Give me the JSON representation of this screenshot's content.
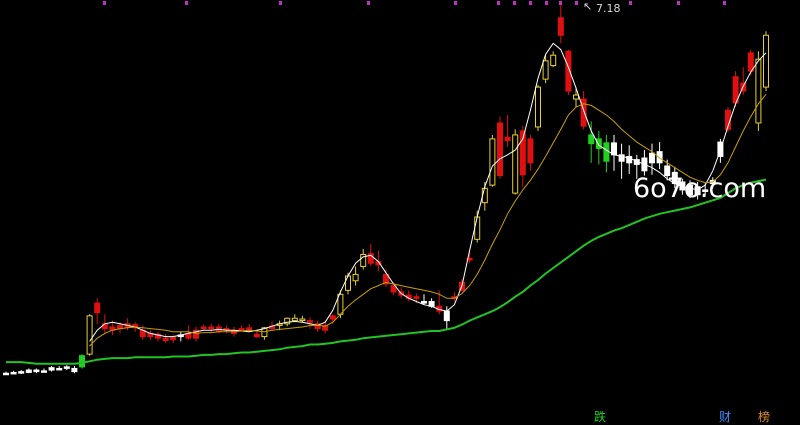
{
  "colors": {
    "background": "#000000",
    "up_candle": "#e01010",
    "down_candle": "#ffffff",
    "yellow_candle": "#e8d030",
    "green_candle": "#20d020",
    "ma_long": "#22c322",
    "ma_mid": "#c8a000",
    "ma_short": "#ffffff",
    "marker": "#c030c0",
    "tag_die": "#20d020",
    "tag_cai": "#3a8cff",
    "tag_bang": "#e08a2a"
  },
  "peak_label": "7.18",
  "watermark": "6o7o.com",
  "tags": {
    "die": "跌",
    "cai": "财",
    "bang": "榜"
  },
  "chart_data": {
    "type": "candlestick",
    "price_range": [
      2.45,
      7.18
    ],
    "max_price": 7.18,
    "candles": [
      {
        "o": 2.56,
        "h": 2.58,
        "l": 2.54,
        "c": 2.55,
        "k": "w"
      },
      {
        "o": 2.57,
        "h": 2.59,
        "l": 2.55,
        "c": 2.56,
        "k": "w"
      },
      {
        "o": 2.58,
        "h": 2.6,
        "l": 2.55,
        "c": 2.57,
        "k": "w"
      },
      {
        "o": 2.6,
        "h": 2.62,
        "l": 2.56,
        "c": 2.57,
        "k": "w"
      },
      {
        "o": 2.58,
        "h": 2.62,
        "l": 2.56,
        "c": 2.6,
        "k": "w"
      },
      {
        "o": 2.59,
        "h": 2.62,
        "l": 2.57,
        "c": 2.58,
        "k": "w"
      },
      {
        "o": 2.6,
        "h": 2.65,
        "l": 2.58,
        "c": 2.63,
        "k": "w"
      },
      {
        "o": 2.62,
        "h": 2.65,
        "l": 2.6,
        "c": 2.61,
        "k": "w"
      },
      {
        "o": 2.63,
        "h": 2.66,
        "l": 2.6,
        "c": 2.64,
        "k": "w"
      },
      {
        "o": 2.62,
        "h": 2.65,
        "l": 2.56,
        "c": 2.58,
        "k": "w"
      },
      {
        "o": 2.64,
        "h": 2.8,
        "l": 2.62,
        "c": 2.78,
        "k": "g"
      },
      {
        "o": 2.8,
        "h": 3.3,
        "l": 2.78,
        "c": 3.28,
        "k": "y"
      },
      {
        "o": 3.32,
        "h": 3.5,
        "l": 3.18,
        "c": 3.44,
        "k": "r"
      },
      {
        "o": 3.18,
        "h": 3.3,
        "l": 3.05,
        "c": 3.12,
        "k": "r"
      },
      {
        "o": 3.14,
        "h": 3.22,
        "l": 3.04,
        "c": 3.1,
        "k": "r"
      },
      {
        "o": 3.12,
        "h": 3.2,
        "l": 3.06,
        "c": 3.16,
        "k": "r"
      },
      {
        "o": 3.18,
        "h": 3.25,
        "l": 3.1,
        "c": 3.14,
        "k": "r"
      },
      {
        "o": 3.13,
        "h": 3.2,
        "l": 3.08,
        "c": 3.17,
        "k": "r"
      },
      {
        "o": 3.1,
        "h": 3.16,
        "l": 2.98,
        "c": 3.02,
        "k": "r"
      },
      {
        "o": 3.02,
        "h": 3.1,
        "l": 2.98,
        "c": 3.06,
        "k": "r"
      },
      {
        "o": 3.05,
        "h": 3.08,
        "l": 2.96,
        "c": 3.0,
        "k": "r"
      },
      {
        "o": 3.0,
        "h": 3.05,
        "l": 2.94,
        "c": 2.97,
        "k": "r"
      },
      {
        "o": 2.98,
        "h": 3.04,
        "l": 2.94,
        "c": 3.01,
        "k": "r"
      },
      {
        "o": 3.02,
        "h": 3.08,
        "l": 2.96,
        "c": 3.04,
        "k": "w"
      },
      {
        "o": 3.06,
        "h": 3.16,
        "l": 2.98,
        "c": 3.0,
        "k": "r"
      },
      {
        "o": 3.0,
        "h": 3.14,
        "l": 2.96,
        "c": 3.1,
        "k": "r"
      },
      {
        "o": 3.12,
        "h": 3.17,
        "l": 3.1,
        "c": 3.14,
        "k": "r"
      },
      {
        "o": 3.12,
        "h": 3.18,
        "l": 3.08,
        "c": 3.14,
        "k": "r"
      },
      {
        "o": 3.14,
        "h": 3.18,
        "l": 3.06,
        "c": 3.08,
        "k": "r"
      },
      {
        "o": 3.1,
        "h": 3.16,
        "l": 3.06,
        "c": 3.12,
        "k": "r"
      },
      {
        "o": 3.1,
        "h": 3.14,
        "l": 3.02,
        "c": 3.06,
        "k": "r"
      },
      {
        "o": 3.12,
        "h": 3.16,
        "l": 3.08,
        "c": 3.1,
        "k": "r"
      },
      {
        "o": 3.13,
        "h": 3.18,
        "l": 3.08,
        "c": 3.11,
        "k": "r"
      },
      {
        "o": 3.05,
        "h": 3.1,
        "l": 3.0,
        "c": 3.02,
        "k": "r"
      },
      {
        "o": 3.02,
        "h": 3.14,
        "l": 2.98,
        "c": 3.13,
        "k": "y"
      },
      {
        "o": 3.15,
        "h": 3.21,
        "l": 3.11,
        "c": 3.12,
        "k": "r"
      },
      {
        "o": 3.16,
        "h": 3.22,
        "l": 3.1,
        "c": 3.18,
        "k": "y"
      },
      {
        "o": 3.18,
        "h": 3.26,
        "l": 3.15,
        "c": 3.25,
        "k": "y"
      },
      {
        "o": 3.25,
        "h": 3.3,
        "l": 3.2,
        "c": 3.22,
        "k": "y"
      },
      {
        "o": 3.24,
        "h": 3.28,
        "l": 3.2,
        "c": 3.23,
        "k": "y"
      },
      {
        "o": 3.22,
        "h": 3.26,
        "l": 3.12,
        "c": 3.2,
        "k": "r"
      },
      {
        "o": 3.18,
        "h": 3.22,
        "l": 3.08,
        "c": 3.12,
        "k": "r"
      },
      {
        "o": 3.16,
        "h": 3.22,
        "l": 3.06,
        "c": 3.1,
        "k": "r"
      },
      {
        "o": 3.24,
        "h": 3.3,
        "l": 3.18,
        "c": 3.28,
        "k": "r"
      },
      {
        "o": 3.3,
        "h": 3.6,
        "l": 3.25,
        "c": 3.55,
        "k": "y"
      },
      {
        "o": 3.6,
        "h": 3.82,
        "l": 3.55,
        "c": 3.78,
        "k": "y"
      },
      {
        "o": 3.72,
        "h": 3.9,
        "l": 3.66,
        "c": 3.8,
        "k": "y"
      },
      {
        "o": 3.9,
        "h": 4.12,
        "l": 3.86,
        "c": 4.05,
        "k": "y"
      },
      {
        "o": 4.06,
        "h": 4.18,
        "l": 3.9,
        "c": 3.94,
        "k": "r"
      },
      {
        "o": 3.96,
        "h": 4.1,
        "l": 3.84,
        "c": 3.92,
        "k": "r"
      },
      {
        "o": 3.8,
        "h": 3.86,
        "l": 3.64,
        "c": 3.68,
        "k": "r"
      },
      {
        "o": 3.66,
        "h": 3.7,
        "l": 3.54,
        "c": 3.58,
        "k": "r"
      },
      {
        "o": 3.58,
        "h": 3.64,
        "l": 3.5,
        "c": 3.54,
        "k": "r"
      },
      {
        "o": 3.54,
        "h": 3.6,
        "l": 3.46,
        "c": 3.5,
        "k": "r"
      },
      {
        "o": 3.5,
        "h": 3.56,
        "l": 3.44,
        "c": 3.52,
        "k": "r"
      },
      {
        "o": 3.46,
        "h": 3.55,
        "l": 3.42,
        "c": 3.44,
        "k": "w"
      },
      {
        "o": 3.46,
        "h": 3.5,
        "l": 3.38,
        "c": 3.4,
        "k": "w"
      },
      {
        "o": 3.4,
        "h": 3.6,
        "l": 3.3,
        "c": 3.34,
        "k": "r"
      },
      {
        "o": 3.34,
        "h": 3.4,
        "l": 3.12,
        "c": 3.22,
        "k": "w"
      },
      {
        "o": 3.5,
        "h": 3.58,
        "l": 3.46,
        "c": 3.52,
        "k": "r"
      },
      {
        "o": 3.6,
        "h": 3.74,
        "l": 3.58,
        "c": 3.7,
        "k": "r"
      },
      {
        "o": 4.0,
        "h": 4.1,
        "l": 3.94,
        "c": 3.98,
        "k": "r"
      },
      {
        "o": 4.24,
        "h": 4.6,
        "l": 4.2,
        "c": 4.52,
        "k": "y"
      },
      {
        "o": 4.7,
        "h": 4.96,
        "l": 4.6,
        "c": 4.88,
        "k": "y"
      },
      {
        "o": 4.92,
        "h": 5.55,
        "l": 4.9,
        "c": 5.5,
        "k": "y"
      },
      {
        "o": 5.7,
        "h": 5.78,
        "l": 5.0,
        "c": 5.04,
        "k": "r"
      },
      {
        "o": 5.52,
        "h": 5.8,
        "l": 5.4,
        "c": 5.48,
        "k": "r"
      },
      {
        "o": 4.82,
        "h": 5.62,
        "l": 4.8,
        "c": 5.55,
        "k": "y"
      },
      {
        "o": 5.6,
        "h": 5.66,
        "l": 4.9,
        "c": 5.05,
        "k": "r"
      },
      {
        "o": 5.2,
        "h": 5.55,
        "l": 5.1,
        "c": 5.5,
        "k": "r"
      },
      {
        "o": 5.65,
        "h": 6.18,
        "l": 5.6,
        "c": 6.15,
        "k": "y"
      },
      {
        "o": 6.25,
        "h": 6.55,
        "l": 6.2,
        "c": 6.48,
        "k": "y"
      },
      {
        "o": 6.55,
        "h": 6.6,
        "l": 6.4,
        "c": 6.42,
        "k": "y"
      },
      {
        "o": 6.8,
        "h": 7.18,
        "l": 6.7,
        "c": 7.02,
        "k": "r"
      },
      {
        "o": 6.6,
        "h": 6.62,
        "l": 6.05,
        "c": 6.1,
        "k": "r"
      },
      {
        "o": 6.0,
        "h": 6.15,
        "l": 5.9,
        "c": 6.05,
        "k": "y"
      },
      {
        "o": 6.0,
        "h": 6.1,
        "l": 5.62,
        "c": 5.66,
        "k": "r"
      },
      {
        "o": 5.55,
        "h": 5.72,
        "l": 5.2,
        "c": 5.44,
        "k": "g"
      },
      {
        "o": 5.5,
        "h": 5.6,
        "l": 5.18,
        "c": 5.38,
        "k": "g"
      },
      {
        "o": 5.45,
        "h": 5.55,
        "l": 5.08,
        "c": 5.22,
        "k": "g"
      },
      {
        "o": 5.3,
        "h": 5.55,
        "l": 5.1,
        "c": 5.45,
        "k": "w"
      },
      {
        "o": 5.22,
        "h": 5.44,
        "l": 5.0,
        "c": 5.3,
        "k": "w"
      },
      {
        "o": 5.28,
        "h": 5.42,
        "l": 5.06,
        "c": 5.2,
        "k": "w"
      },
      {
        "o": 5.18,
        "h": 5.3,
        "l": 5.0,
        "c": 5.24,
        "k": "w"
      },
      {
        "o": 5.26,
        "h": 5.36,
        "l": 5.04,
        "c": 5.1,
        "k": "w"
      },
      {
        "o": 5.2,
        "h": 5.44,
        "l": 5.05,
        "c": 5.32,
        "k": "w"
      },
      {
        "o": 5.34,
        "h": 5.46,
        "l": 5.12,
        "c": 5.2,
        "k": "w"
      },
      {
        "o": 5.16,
        "h": 5.24,
        "l": 4.98,
        "c": 5.04,
        "k": "w"
      },
      {
        "o": 5.08,
        "h": 5.15,
        "l": 4.88,
        "c": 4.94,
        "k": "w"
      },
      {
        "o": 4.96,
        "h": 5.0,
        "l": 4.8,
        "c": 4.86,
        "k": "w"
      },
      {
        "o": 4.92,
        "h": 4.98,
        "l": 4.76,
        "c": 4.8,
        "k": "w"
      },
      {
        "o": 4.8,
        "h": 4.96,
        "l": 4.74,
        "c": 4.9,
        "k": "w"
      },
      {
        "o": 4.86,
        "h": 4.94,
        "l": 4.8,
        "c": 4.84,
        "k": "w"
      },
      {
        "o": 4.94,
        "h": 5.02,
        "l": 4.88,
        "c": 4.98,
        "k": "w"
      },
      {
        "o": 5.28,
        "h": 5.5,
        "l": 5.2,
        "c": 5.46,
        "k": "w"
      },
      {
        "o": 5.62,
        "h": 5.9,
        "l": 5.58,
        "c": 5.86,
        "k": "r"
      },
      {
        "o": 5.95,
        "h": 6.35,
        "l": 5.9,
        "c": 6.28,
        "k": "r"
      },
      {
        "o": 6.1,
        "h": 6.4,
        "l": 6.05,
        "c": 6.2,
        "k": "r"
      },
      {
        "o": 6.35,
        "h": 6.62,
        "l": 6.3,
        "c": 6.58,
        "k": "r"
      },
      {
        "o": 5.7,
        "h": 6.6,
        "l": 5.6,
        "c": 6.5,
        "k": "y"
      },
      {
        "o": 6.15,
        "h": 6.85,
        "l": 6.1,
        "c": 6.8,
        "k": "y"
      }
    ],
    "ma_long": [
      2.7,
      2.7,
      2.7,
      2.69,
      2.68,
      2.68,
      2.68,
      2.68,
      2.68,
      2.68,
      2.69,
      2.71,
      2.73,
      2.74,
      2.75,
      2.75,
      2.75,
      2.76,
      2.76,
      2.76,
      2.76,
      2.76,
      2.77,
      2.77,
      2.77,
      2.78,
      2.79,
      2.79,
      2.8,
      2.8,
      2.81,
      2.82,
      2.82,
      2.83,
      2.84,
      2.85,
      2.86,
      2.88,
      2.89,
      2.9,
      2.92,
      2.92,
      2.93,
      2.94,
      2.96,
      2.97,
      2.98,
      3.0,
      3.01,
      3.02,
      3.03,
      3.04,
      3.05,
      3.06,
      3.07,
      3.08,
      3.09,
      3.09,
      3.11,
      3.13,
      3.17,
      3.22,
      3.26,
      3.3,
      3.34,
      3.39,
      3.45,
      3.52,
      3.58,
      3.66,
      3.73,
      3.81,
      3.88,
      3.95,
      4.02,
      4.09,
      4.16,
      4.22,
      4.27,
      4.31,
      4.35,
      4.38,
      4.42,
      4.46,
      4.5,
      4.53,
      4.56,
      4.58,
      4.6,
      4.62,
      4.64,
      4.67,
      4.7,
      4.73,
      4.76,
      4.82,
      4.88,
      4.92,
      4.95,
      4.97,
      4.99
    ],
    "ma_mid": [
      null,
      null,
      null,
      null,
      null,
      null,
      null,
      null,
      null,
      null,
      null,
      2.9,
      3.0,
      3.06,
      3.1,
      3.12,
      3.13,
      3.14,
      3.13,
      3.12,
      3.11,
      3.1,
      3.08,
      3.08,
      3.08,
      3.06,
      3.07,
      3.07,
      3.08,
      3.08,
      3.08,
      3.09,
      3.1,
      3.09,
      3.08,
      3.1,
      3.11,
      3.12,
      3.13,
      3.14,
      3.16,
      3.16,
      3.15,
      3.2,
      3.3,
      3.4,
      3.48,
      3.55,
      3.62,
      3.66,
      3.7,
      3.68,
      3.66,
      3.64,
      3.62,
      3.6,
      3.58,
      3.55,
      3.5,
      3.5,
      3.56,
      3.66,
      3.8,
      3.98,
      4.18,
      4.36,
      4.56,
      4.72,
      4.86,
      4.98,
      5.12,
      5.28,
      5.45,
      5.62,
      5.8,
      5.9,
      5.94,
      5.92,
      5.86,
      5.8,
      5.72,
      5.62,
      5.54,
      5.46,
      5.4,
      5.34,
      5.26,
      5.2,
      5.14,
      5.08,
      5.02,
      4.98,
      4.95,
      4.96,
      5.05,
      5.2,
      5.4,
      5.6,
      5.78,
      5.94,
      6.06
    ],
    "ma_short": [
      null,
      null,
      null,
      null,
      null,
      null,
      null,
      null,
      null,
      null,
      null,
      2.96,
      3.1,
      3.18,
      3.2,
      3.18,
      3.16,
      3.14,
      3.1,
      3.06,
      3.04,
      3.02,
      3.02,
      3.04,
      3.06,
      3.08,
      3.1,
      3.1,
      3.11,
      3.1,
      3.1,
      3.09,
      3.08,
      3.1,
      3.12,
      3.15,
      3.18,
      3.2,
      3.21,
      3.2,
      3.18,
      3.16,
      3.2,
      3.35,
      3.58,
      3.78,
      3.94,
      4.02,
      4.04,
      3.96,
      3.82,
      3.68,
      3.56,
      3.5,
      3.46,
      3.42,
      3.4,
      3.36,
      3.34,
      3.42,
      3.66,
      4.1,
      4.52,
      4.9,
      5.16,
      5.25,
      5.3,
      5.36,
      5.5,
      5.86,
      6.26,
      6.56,
      6.7,
      6.62,
      6.4,
      6.14,
      5.86,
      5.6,
      5.42,
      5.36,
      5.3,
      5.28,
      5.26,
      5.22,
      5.18,
      5.14,
      5.08,
      5.0,
      4.94,
      4.9,
      4.88,
      4.86,
      4.92,
      5.1,
      5.36,
      5.66,
      5.94,
      6.16,
      6.34,
      6.48,
      6.58
    ]
  }
}
